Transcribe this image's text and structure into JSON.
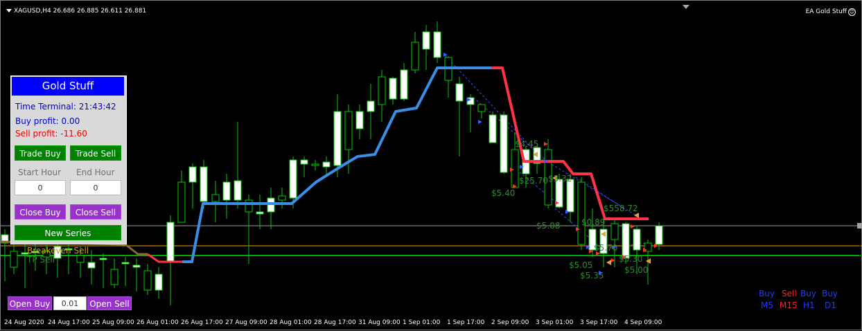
{
  "header": {
    "symbol": "XAGUSD,H4",
    "quotes": "26.686 26.885 26.611 26.881",
    "ea": "EA Gold Stuff"
  },
  "panel": {
    "title": "Gold Stuff",
    "time_label": "Time Terminal:",
    "time_value": "21:43:42",
    "buy_profit_label": "Buy profit:",
    "buy_profit": "0.00",
    "sell_profit_label": "Sell profit:",
    "sell_profit": "-11.60",
    "trade_buy": "Trade Buy",
    "trade_sell": "Trade Sell",
    "start_hour_label": "Start Hour",
    "end_hour_label": "End Hour",
    "start_hour": "0",
    "end_hour": "0",
    "close_buy": "Close Buy",
    "close_sell": "Close Sell",
    "new_series": "New Series"
  },
  "bottom": {
    "open_buy": "Open Buy",
    "lot": "0.01",
    "open_sell": "Open Sell"
  },
  "levels": {
    "breakeven_label": "Breakeven Sell",
    "tp_label": "TP Sell"
  },
  "signals": [
    {
      "dir": "Buy",
      "tf": "M5"
    },
    {
      "dir": "Sell",
      "tf": "M15"
    },
    {
      "dir": "Buy",
      "tf": "H1"
    },
    {
      "dir": "Buy",
      "tf": "D1"
    }
  ],
  "profit_labels": [
    "$4.45",
    "$5.40",
    "$25.70",
    "$3.32",
    "$5.08",
    "$558.72",
    "$0.89",
    "$5.05",
    "$5.35",
    "$5.00",
    "$5.70",
    "$5.30"
  ],
  "x_axis_labels": [
    "24 Aug 2020",
    "24 Aug 17:00",
    "25 Aug 09:00",
    "26 Aug 01:00",
    "26 Aug 17:00",
    "27 Aug 09:00",
    "28 Aug 01:00",
    "28 Aug 17:00",
    "31 Aug 09:00",
    "1 Sep 01:00",
    "1 Sep 17:00",
    "2 Sep 09:00",
    "3 Sep 01:00",
    "3 Sep 17:00",
    "4 Sep 09:00"
  ],
  "colors": {
    "bull_candle": "#ffffff",
    "candle_outline": "#00cc00",
    "trend_up": "#3a8ee6",
    "trend_down": "#ff3344",
    "tp_line": "#00aa00",
    "breakeven_line": "#ff9a00",
    "price_line": "#a0a0a0",
    "profit_text": "#2e8b2e"
  }
}
